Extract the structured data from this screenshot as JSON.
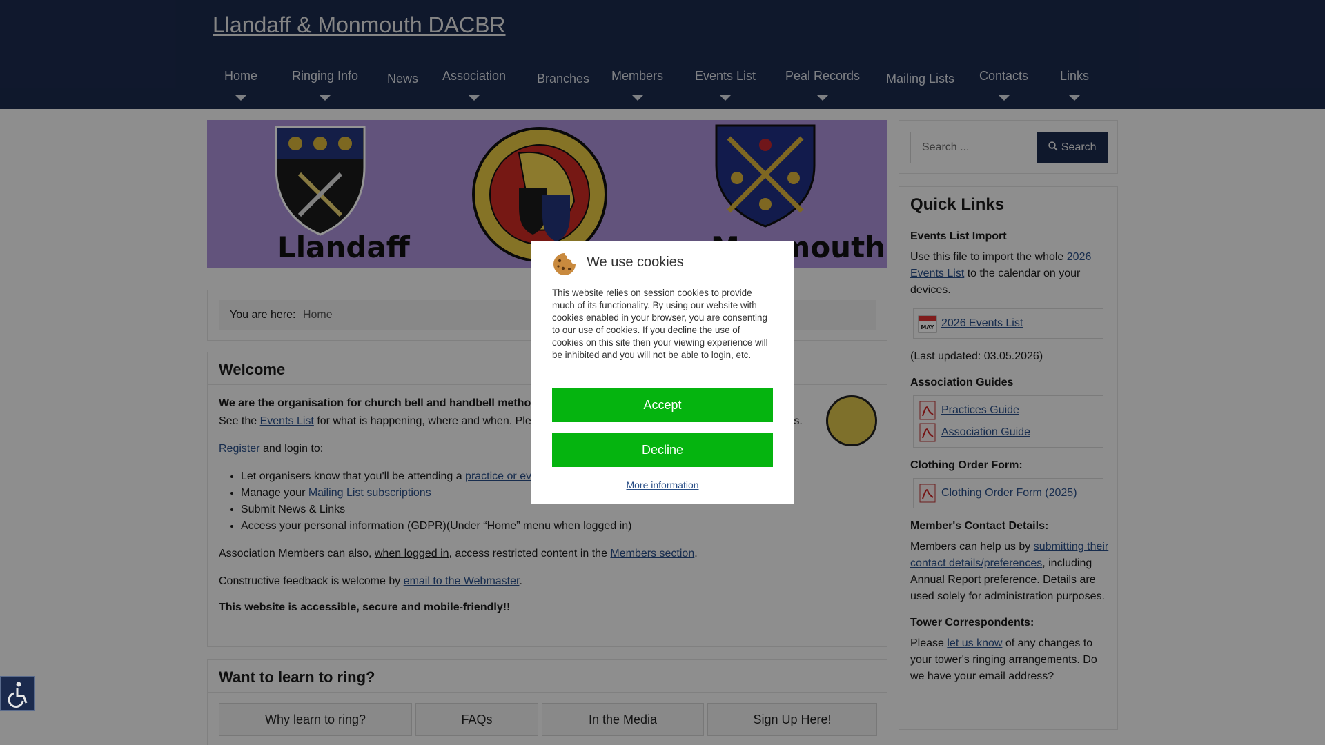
{
  "site": {
    "title": "Llandaff & Monmouth DACBR"
  },
  "nav": [
    {
      "label": "Home",
      "has_submenu": true,
      "active": true
    },
    {
      "label": "Ringing Info",
      "has_submenu": true
    },
    {
      "label": "News",
      "has_submenu": false
    },
    {
      "label": "Association",
      "has_submenu": true
    },
    {
      "label": "Branches",
      "has_submenu": false
    },
    {
      "label": "Members",
      "has_submenu": true
    },
    {
      "label": "Events List",
      "has_submenu": true
    },
    {
      "label": "Peal Records",
      "has_submenu": true
    },
    {
      "label": "Mailing Lists",
      "has_submenu": false
    },
    {
      "label": "Contacts",
      "has_submenu": true
    },
    {
      "label": "Links",
      "has_submenu": true
    }
  ],
  "banner": {
    "left_text": "Llandaff",
    "right_text": "Monmouth"
  },
  "breadcrumb": {
    "prefix": "You are here:",
    "current": "Home"
  },
  "welcome": {
    "title": "Welcome",
    "intro": "We are the organisation for church bell and handbell method ringing in the Dioceses of Llandaff and Monmouth.",
    "line2_pre": "See the ",
    "line2_link": "Events List",
    "line2_post": " for what is happening, where and when. Please check with organisers before travelling to practices.",
    "register_link": "Register",
    "register_post": " and login to:",
    "bullets": {
      "b1_pre": "Let organisers know that you'll be attending a ",
      "b1_link": "practice or event",
      "b2_pre": "Manage your ",
      "b2_link": "Mailing List subscriptions",
      "b3": "Submit News & Links",
      "b4_pre": "Access your personal information (GDPR)(Under “Home” menu ",
      "b4_link": "when logged in",
      "b4_post": ")"
    },
    "members_pre": "Association Members can also, ",
    "members_link1": "when logged in",
    "members_mid": ", access restricted content in the ",
    "members_link2": "Members section",
    "members_post": ".",
    "feedback_pre": "Constructive feedback is welcome by ",
    "feedback_link": "email to the Webmaster",
    "feedback_post": ".",
    "accessible": "This website is accessible, secure and mobile-friendly!!"
  },
  "learn": {
    "title": "Want to learn to ring?",
    "tabs": [
      "Why learn to ring?",
      "FAQs",
      "In the Media",
      "Sign Up Here!"
    ]
  },
  "search": {
    "placeholder": "Search ...",
    "button": "Search"
  },
  "quick_links": {
    "title": "Quick Links",
    "events_heading": "Events List Import",
    "events_pre": "Use this file to import the whole ",
    "events_link": "2026 Events List",
    "events_post": " to the calendar on your devices.",
    "events_file": "2026 Events List",
    "calendar_month": "MAY",
    "updated": "(Last updated: 03.05.2026)",
    "guides_heading": "Association Guides",
    "guides": [
      "Practices Guide",
      "Association Guide"
    ],
    "clothing_heading": "Clothing Order Form:",
    "clothing_file": "Clothing Order Form (2025)",
    "contact_heading": "Member's Contact Details:",
    "contact_pre": "Members can help us by ",
    "contact_link": "submitting their contact details/preferences",
    "contact_post": ", including Annual Report preference. Details are used solely for administration purposes.",
    "tower_heading": "Tower Correspondents:",
    "tower_pre": "Please ",
    "tower_link": "let us know",
    "tower_post": " of any changes to your tower's ringing arrangements. Do we have your email address?"
  },
  "cookies": {
    "title": "We use cookies",
    "text": "This website relies on session cookies to provide much of its functionality. By using our website with cookies enabled in your browser, you are consenting to our use of cookies. If you decline the use of cookies on this site then your viewing experience will be inhibited and you will not be able to login, etc.",
    "accept": "Accept",
    "decline": "Decline",
    "more": "More information"
  },
  "colors": {
    "header": "#1b2a4d",
    "banner": "#a98fd6",
    "accept": "#05b40f",
    "link": "#2a4f87"
  }
}
